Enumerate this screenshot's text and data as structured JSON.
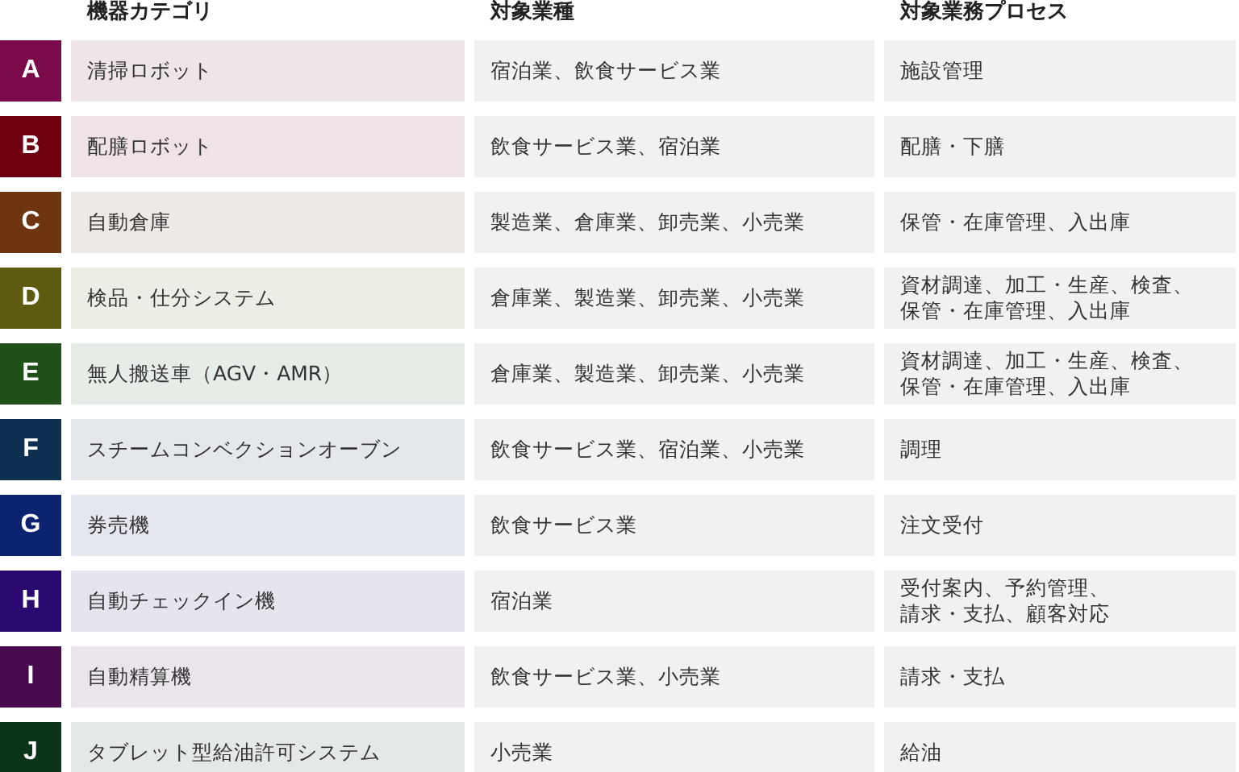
{
  "columns": [
    "機器カテゴリ",
    "対象業種",
    "対象業務プロセス"
  ],
  "rows": [
    {
      "letter": "A",
      "color": "#7a0a4a",
      "category": "清掃ロボット",
      "industries": "宿泊業、飲食サービス業",
      "processes": [
        "施設管理"
      ]
    },
    {
      "letter": "B",
      "color": "#6e0010",
      "category": "配膳ロボット",
      "industries": "飲食サービス業、宿泊業",
      "processes": [
        "配膳・下膳"
      ]
    },
    {
      "letter": "C",
      "color": "#6e3510",
      "category": "自動倉庫",
      "industries": "製造業、倉庫業、卸売業、小売業",
      "processes": [
        "保管・在庫管理、入出庫"
      ]
    },
    {
      "letter": "D",
      "color": "#5e5a10",
      "category": "検品・仕分システム",
      "industries": "倉庫業、製造業、卸売業、小売業",
      "processes": [
        "資材調達、加工・生産、検査、",
        "保管・在庫管理、入出庫"
      ]
    },
    {
      "letter": "E",
      "color": "#1e5018",
      "category": "無人搬送車（AGV・AMR）",
      "industries": "倉庫業、製造業、卸売業、小売業",
      "processes": [
        "資材調達、加工・生産、検査、",
        "保管・在庫管理、入出庫"
      ]
    },
    {
      "letter": "F",
      "color": "#0e3050",
      "category": "スチームコンベクションオーブン",
      "industries": "飲食サービス業、宿泊業、小売業",
      "processes": [
        "調理"
      ]
    },
    {
      "letter": "G",
      "color": "#0c2470",
      "category": "券売機",
      "industries": "飲食サービス業",
      "processes": [
        "注文受付"
      ]
    },
    {
      "letter": "H",
      "color": "#2a0a70",
      "category": "自動チェックイン機",
      "industries": "宿泊業",
      "processes": [
        "受付案内、予約管理、",
        "請求・支払、顧客対応"
      ]
    },
    {
      "letter": "I",
      "color": "#4a0a4e",
      "category": "自動精算機",
      "industries": "飲食サービス業、小売業",
      "processes": [
        "請求・支払"
      ]
    },
    {
      "letter": "J",
      "color": "#0c3418",
      "category": "タブレット型給油許可システム",
      "industries": "小売業",
      "processes": [
        "給油"
      ]
    }
  ]
}
